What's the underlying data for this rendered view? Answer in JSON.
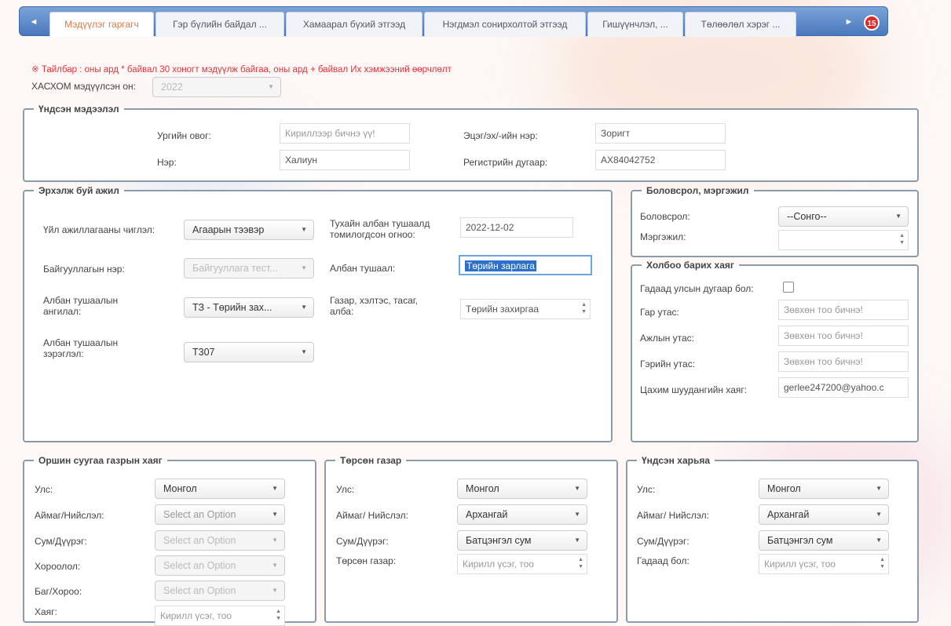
{
  "tabs": [
    "Мэдүүлэг гаргагч",
    "Гэр бүлийн байдал ...",
    "Хамаарал бүхий этгээд",
    "Нэгдмэл сонирхолтой этгээд",
    "Гишүүнчлэл, ...",
    "Төлөөлөл хэрэг ..."
  ],
  "tab_nav": {
    "prev": "◄",
    "next": "►",
    "close_badge": "15"
  },
  "note": "※ Тайлбар : оны ард * байвал 30 хоногт мэдүүлж байгаа, оны ард + байвал Их хэмжээний өөрчлөлт",
  "year": {
    "label": "ХАСХОМ мэдүүлсэн он:",
    "value": "2022"
  },
  "basic": {
    "title": "Үндсэн мэдээлэл",
    "surname_label": "Ургийн овог:",
    "surname_value": "Кириллээр бичнэ үү!",
    "name_label": "Нэр:",
    "name_value": "Халиун",
    "father_label": "Эцэг/эх/-ийн нэр:",
    "father_value": "Зоригт",
    "reg_label": "Регистрийн дугаар:",
    "reg_value": "АХ84042752"
  },
  "job": {
    "title": "Эрхэлж буй ажил",
    "activity_label": "Үйл ажиллагааны чиглэл:",
    "activity_value": "Агаарын тээвэр",
    "org_label": "Байгууллагын нэр:",
    "org_value": "Байгууллага тест...",
    "class_label": "Албан тушаалын ангилал:",
    "class_value": "ТЗ - Төрийн зах...",
    "rank_label": "Албан тушаалын зэрэглэл:",
    "rank_value": "Т307",
    "date_label": "Тухайн албан тушаалд томилогдсон огноо:",
    "date_value": "2022-12-02",
    "position_label": "Албан тушаал:",
    "position_value": "Төрийн зарлага",
    "dept_label": "Газар, хэлтэс, тасаг, алба:",
    "dept_value": "Төрийн захиргаа"
  },
  "education": {
    "title": "Боловсрол, мэргэжил",
    "edu_label": "Боловсрол:",
    "edu_value": "--Сонго--",
    "prof_label": "Мэргэжил:"
  },
  "contact": {
    "title": "Холбоо барих хаяг",
    "foreign_label": "Гадаад улсын дугаар бол:",
    "mobile_label": "Гар утас:",
    "mobile_ph": "Зөвхөн тоо бичнэ!",
    "work_label": "Ажлын утас:",
    "work_ph": "Зөвхөн тоо бичнэ!",
    "home_label": "Гэрийн утас:",
    "home_ph": "Зөвхөн тоо бичнэ!",
    "email_label": "Цахим шуудангийн хаяг:",
    "email_value": "gerlee247200@yahoo.c"
  },
  "residence": {
    "title": "Оршин суугаа газрын хаяг",
    "country_label": "Улс:",
    "country_value": "Монгол",
    "aimag_label": "Аймаг/Нийслэл:",
    "aimag_value": "Select an Option",
    "sum_label": "Сум/Дүүрэг:",
    "sum_value": "Select an Option",
    "khoroolol_label": "Хороолол:",
    "khoroolol_value": "Select an Option",
    "bag_label": "Баг/Хороо:",
    "bag_value": "Select an Option",
    "address_label": "Хаяг:",
    "address_ph": "Кирилл үсэг, тоо"
  },
  "birthplace": {
    "title": "Төрсөн газар",
    "country_label": "Улс:",
    "country_value": "Монгол",
    "aimag_label": "Аймаг/ Нийслэл:",
    "aimag_value": "Архангай",
    "sum_label": "Сум/Дүүрэг:",
    "sum_value": "Батцэнгэл сум",
    "place_label": "Төрсөн газар:",
    "place_ph": "Кирилл үсэг, тоо"
  },
  "origin": {
    "title": "Үндсэн харьяа",
    "country_label": "Улс:",
    "country_value": "Монгол",
    "aimag_label": "Аймаг/ Нийслэл:",
    "aimag_value": "Архангай",
    "sum_label": "Сум/Дүүрэг:",
    "sum_value": "Батцэнгэл сум",
    "foreign_label": "Гадаад бол:",
    "foreign_ph": "Кирилл үсэг, тоо"
  }
}
